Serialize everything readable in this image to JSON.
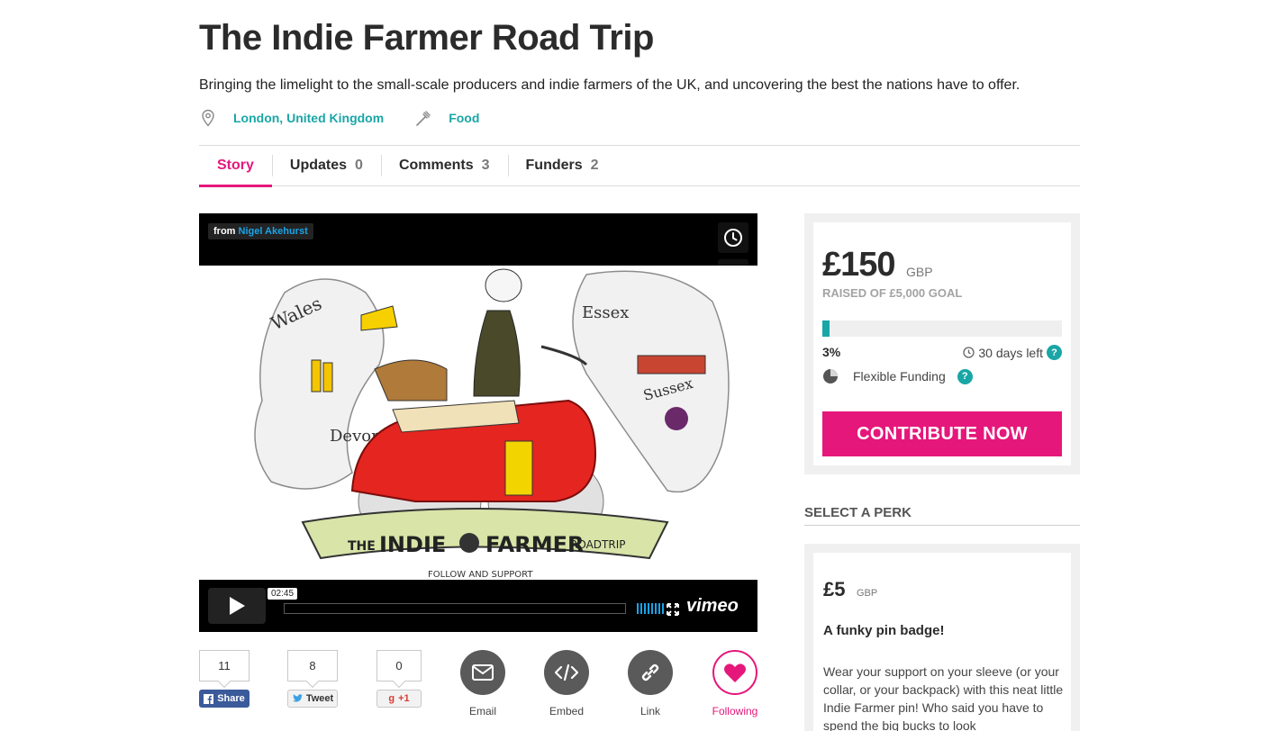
{
  "project": {
    "title": "The Indie Farmer Road Trip",
    "subtitle": "Bringing the limelight to the small-scale producers and indie farmers of the UK, and uncovering the best the nations have to offer.",
    "location": "London, United Kingdom",
    "category": "Food"
  },
  "tabs": [
    {
      "label": "Story",
      "count": ""
    },
    {
      "label": "Updates",
      "count": "0"
    },
    {
      "label": "Comments",
      "count": "3"
    },
    {
      "label": "Funders",
      "count": "2"
    }
  ],
  "video": {
    "from_label": "from",
    "author": "Nigel Akehurst",
    "time": "02:45",
    "brand": "vimeo",
    "art_labels": [
      "Wales",
      "Essex",
      "Sussex",
      "Devon",
      "THE",
      "INDIE",
      "FARMER",
      "ROADTRIP",
      "FOLLOW AND SUPPORT"
    ]
  },
  "share": {
    "facebook_count": "11",
    "facebook_label": "Share",
    "twitter_count": "8",
    "twitter_label": "Tweet",
    "gplus_count": "0",
    "gplus_label": "+1",
    "email_label": "Email",
    "embed_label": "Embed",
    "link_label": "Link",
    "following_label": "Following"
  },
  "funding": {
    "amount": "£150",
    "currency": "GBP",
    "raised_text": "RAISED OF £5,000 GOAL",
    "percent_text": "3%",
    "percent_value": 3,
    "days_left": "30 days left",
    "help": "?",
    "funding_type": "Flexible Funding",
    "cta": "CONTRIBUTE NOW"
  },
  "perks": {
    "heading": "SELECT A PERK",
    "items": [
      {
        "amount": "£5",
        "currency": "GBP",
        "title": "A funky pin badge!",
        "description": "Wear your support on your sleeve (or your collar, or your backpack) with this neat little Indie Farmer pin! Who said you have to spend the big bucks to look"
      }
    ]
  },
  "colors": {
    "accent": "#e5177b",
    "teal": "#1aa6a6",
    "vimeo_blue": "#1aa3e6",
    "facebook": "#3b5a9a"
  }
}
